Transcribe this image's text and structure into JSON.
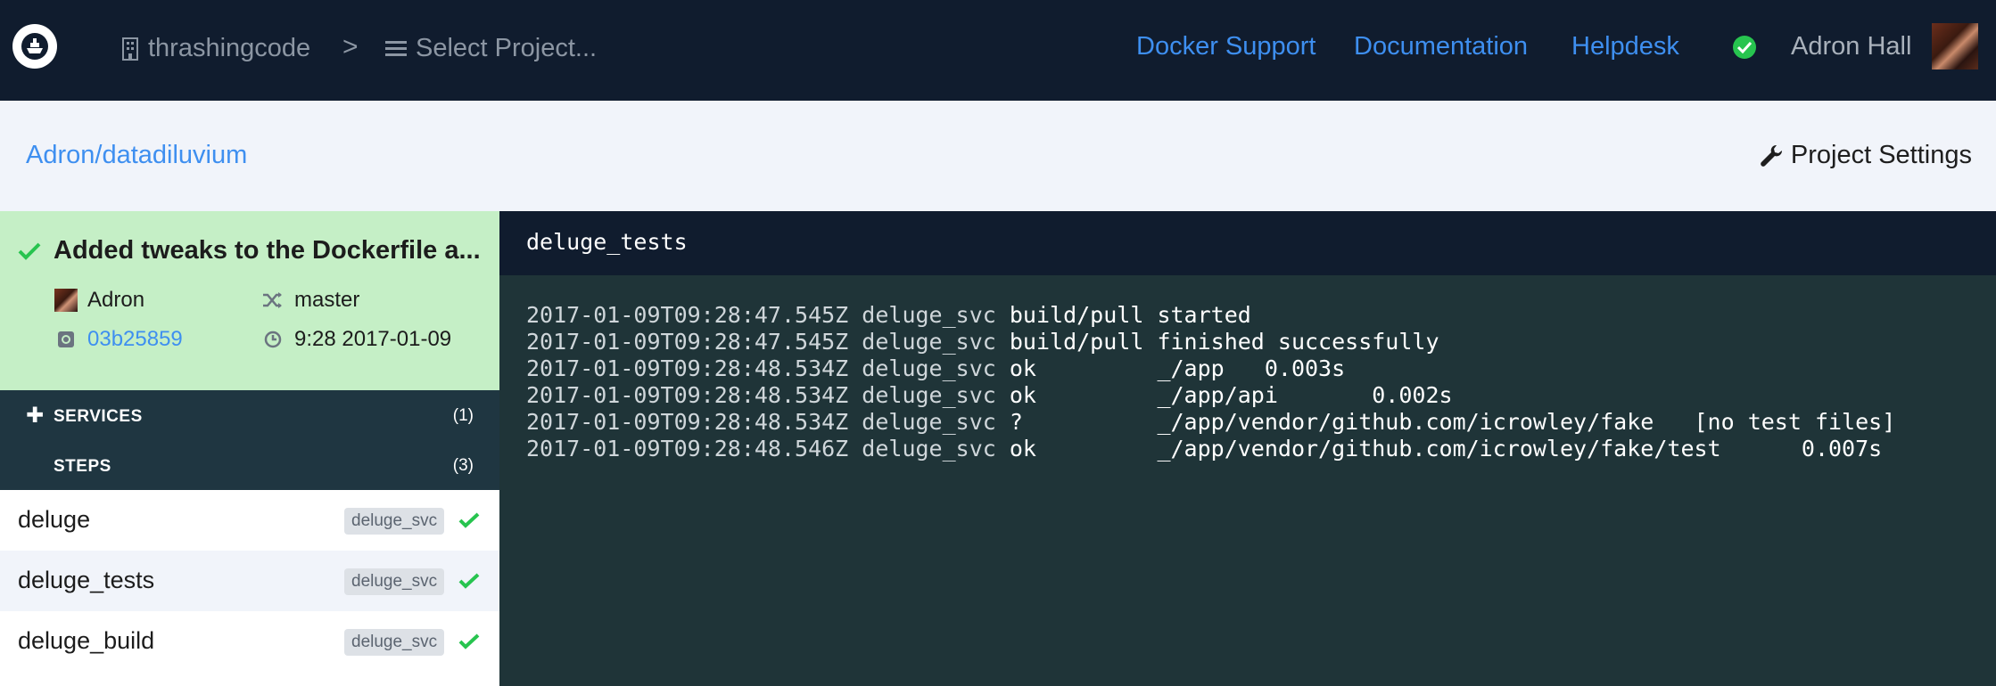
{
  "topbar": {
    "org": "thrashingcode",
    "breadcrumb_separator": ">",
    "project_select": "Select Project...",
    "links": [
      "Docker Support",
      "Documentation",
      "Helpdesk"
    ],
    "user": "Adron Hall",
    "accent_color": "#3e8ff0",
    "status_color": "#27c44f"
  },
  "subheader": {
    "repo": "Adron/datadiluvium",
    "settings_label": "Project Settings"
  },
  "build": {
    "title": "Added tweaks to the Dockerfile a...",
    "author": "Adron",
    "branch": "master",
    "commit": "03b25859",
    "time": "9:28 2017-01-09"
  },
  "sidebar": {
    "services_label": "SERVICES",
    "services_count": "(1)",
    "steps_label": "STEPS",
    "steps_count": "(3)",
    "steps": [
      {
        "name": "deluge",
        "service": "deluge_svc",
        "status": "success"
      },
      {
        "name": "deluge_tests",
        "service": "deluge_svc",
        "status": "success"
      },
      {
        "name": "deluge_build",
        "service": "deluge_svc",
        "status": "success"
      }
    ]
  },
  "log": {
    "title": "deluge_tests",
    "lines": [
      {
        "ts": "2017-01-09T09:28:47.545Z",
        "svc": "deluge_svc",
        "msg": "build/pull started"
      },
      {
        "ts": "2017-01-09T09:28:47.545Z",
        "svc": "deluge_svc",
        "msg": "build/pull finished successfully"
      },
      {
        "ts": "2017-01-09T09:28:48.534Z",
        "svc": "deluge_svc",
        "msg": "ok         _/app   0.003s"
      },
      {
        "ts": "2017-01-09T09:28:48.534Z",
        "svc": "deluge_svc",
        "msg": "ok         _/app/api       0.002s"
      },
      {
        "ts": "2017-01-09T09:28:48.534Z",
        "svc": "deluge_svc",
        "msg": "?          _/app/vendor/github.com/icrowley/fake   [no test files]"
      },
      {
        "ts": "2017-01-09T09:28:48.546Z",
        "svc": "deluge_svc",
        "msg": "ok         _/app/vendor/github.com/icrowley/fake/test      0.007s"
      }
    ]
  }
}
